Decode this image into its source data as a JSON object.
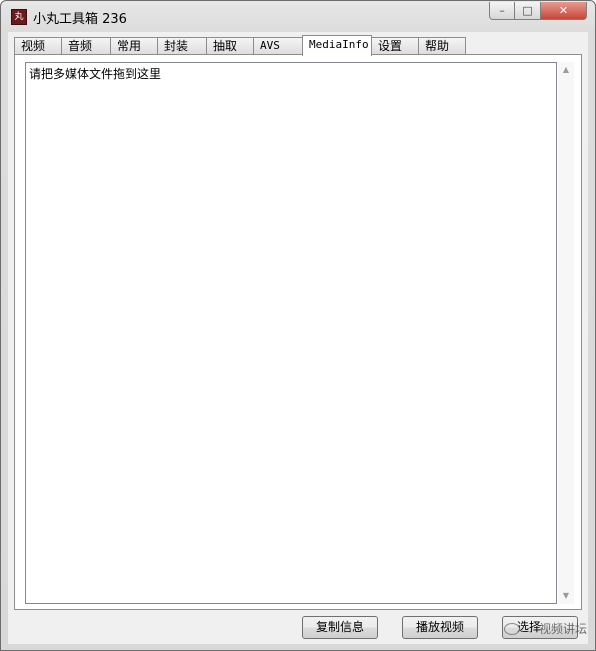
{
  "window": {
    "title": "小丸工具箱 236",
    "icon_glyph": "丸",
    "controls": {
      "minimize": "–",
      "maximize": "□",
      "close": "✕"
    }
  },
  "tabs": [
    {
      "label": "视频",
      "active": false
    },
    {
      "label": "音频",
      "active": false
    },
    {
      "label": "常用",
      "active": false
    },
    {
      "label": "封装",
      "active": false
    },
    {
      "label": "抽取",
      "active": false
    },
    {
      "label": "AVS",
      "active": false
    },
    {
      "label": "MediaInfo",
      "active": true
    },
    {
      "label": "设置",
      "active": false
    },
    {
      "label": "帮助",
      "active": false
    }
  ],
  "mediainfo": {
    "drop_hint": "请把多媒体文件拖到这里",
    "scroll_up": "▲",
    "scroll_down": "▼"
  },
  "buttons": {
    "copy_info": "复制信息",
    "play_video": "播放视频",
    "choose_file": "选择"
  },
  "watermark": "视频讲坛"
}
